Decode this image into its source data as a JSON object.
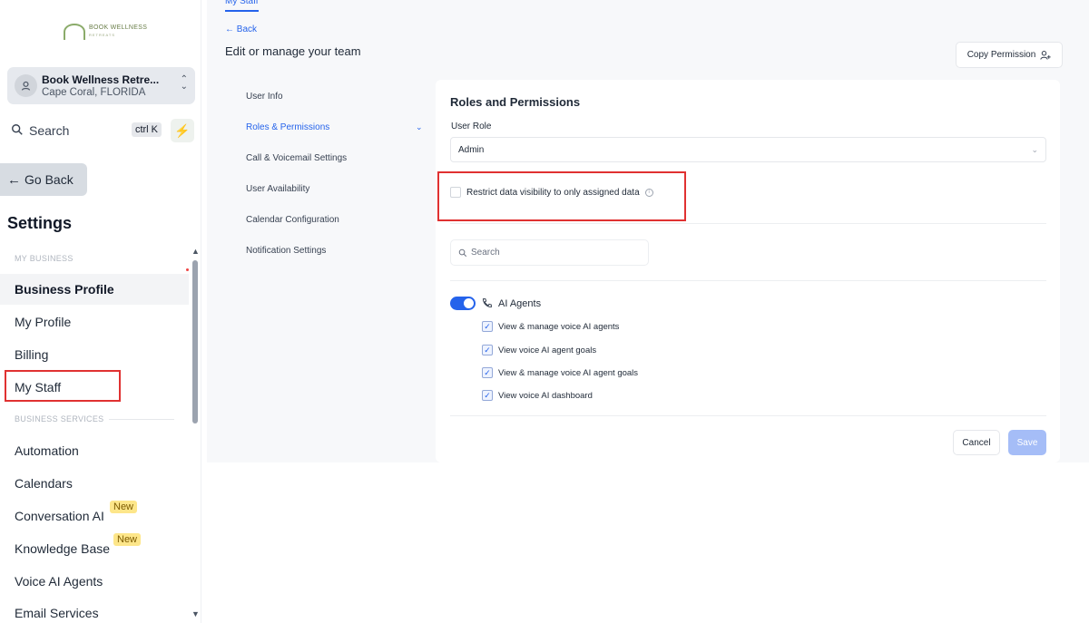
{
  "logo": {
    "text": "BOOK WELLNESS",
    "sub": "RETREATS"
  },
  "account": {
    "name": "Book Wellness Retre...",
    "location": "Cape Coral, FLORIDA"
  },
  "search": {
    "label": "Search",
    "shortcut": "ctrl K"
  },
  "sidebar": {
    "go_back": "Go Back",
    "title": "Settings",
    "section_my_business": "MY BUSINESS",
    "section_business_services": "BUSINESS SERVICES",
    "items": [
      {
        "label": "Business Profile",
        "active": true
      },
      {
        "label": "My Profile"
      },
      {
        "label": "Billing"
      },
      {
        "label": "My Staff"
      },
      {
        "label": "Automation"
      },
      {
        "label": "Calendars"
      },
      {
        "label": "Conversation AI",
        "badge": "New"
      },
      {
        "label": "Knowledge Base",
        "badge": "New"
      },
      {
        "label": "Voice AI Agents"
      },
      {
        "label": "Email Services"
      }
    ]
  },
  "main": {
    "top_tab": "My Staff",
    "back": "Back",
    "page_title": "Edit or manage your team",
    "copy_permission": "Copy Permission",
    "subnav": [
      {
        "label": "User Info"
      },
      {
        "label": "Roles & Permissions",
        "active": true
      },
      {
        "label": "Call & Voicemail Settings"
      },
      {
        "label": "User Availability"
      },
      {
        "label": "Calendar Configuration"
      },
      {
        "label": "Notification Settings"
      }
    ],
    "card": {
      "title": "Roles and Permissions",
      "user_role_label": "User Role",
      "user_role_value": "Admin",
      "restrict_label": "Restrict data visibility to only assigned data",
      "search_placeholder": "Search",
      "group_label": "AI Agents",
      "group_enabled": true,
      "permissions": [
        "View & manage voice AI agents",
        "View voice AI agent goals",
        "View & manage voice AI agent goals",
        "View voice AI dashboard"
      ],
      "cancel": "Cancel",
      "save": "Save"
    }
  },
  "colors": {
    "accent": "#2563eb",
    "highlight": "#e03131",
    "badge": "#fde68a"
  }
}
